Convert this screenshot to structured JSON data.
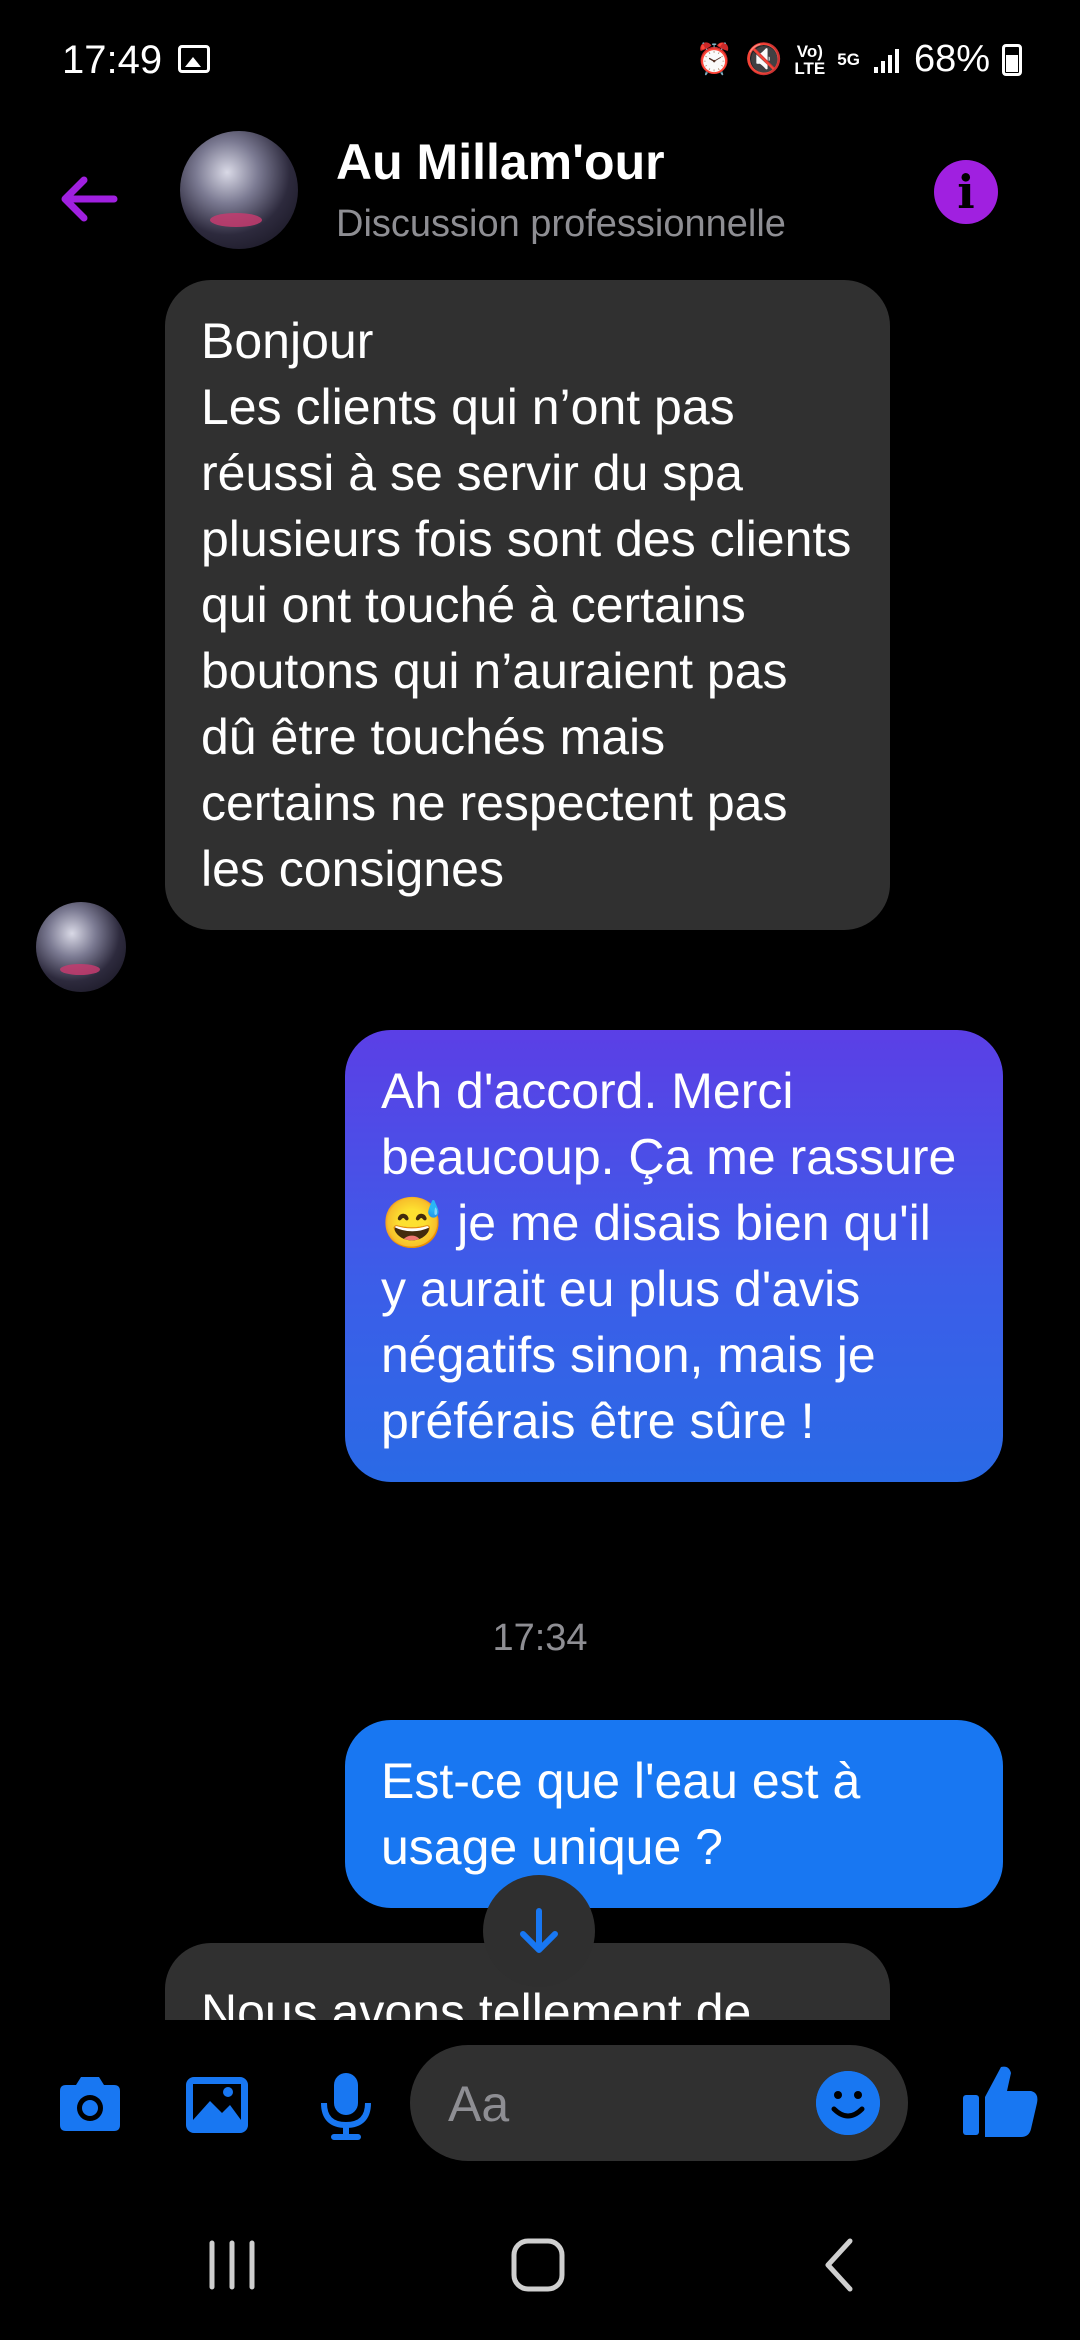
{
  "status_bar": {
    "time": "17:49",
    "network_small_1": "Vo)\nLTE",
    "network_small_2": "5G",
    "battery": "68%"
  },
  "header": {
    "back_icon": "arrow-left-icon",
    "title": "Au Millam'our",
    "subtitle": "Discussion professionnelle",
    "info_icon": "info-icon",
    "accent_color": "#a020e0"
  },
  "messages": [
    {
      "direction": "incoming",
      "text": "Bonjour\nLes clients qui n’ont pas réussi à se servir du spa plusieurs fois sont des clients qui ont touché à certains boutons qui n’auraient pas dû être touchés mais certains ne respectent pas les consignes"
    },
    {
      "direction": "outgoing",
      "text": "Ah d'accord. Merci beaucoup.  Ça me rassure 😅 je me disais bien qu'il y aurait eu plus d'avis négatifs sinon, mais je préférais être sûre !"
    },
    {
      "direction": "timestamp",
      "text": "17:34"
    },
    {
      "direction": "outgoing",
      "text": "Est-ce que l'eau est à usage unique ?"
    },
    {
      "direction": "incoming",
      "text": "Nous avons tellement de"
    }
  ],
  "composer": {
    "placeholder": "Aa",
    "icons": [
      "camera-icon",
      "gallery-icon",
      "microphone-icon",
      "emoji-icon",
      "thumbs-up-icon"
    ],
    "button_color": "#1877f2"
  },
  "navbar": {
    "icons": [
      "recent-apps-icon",
      "home-icon",
      "back-nav-icon"
    ]
  }
}
